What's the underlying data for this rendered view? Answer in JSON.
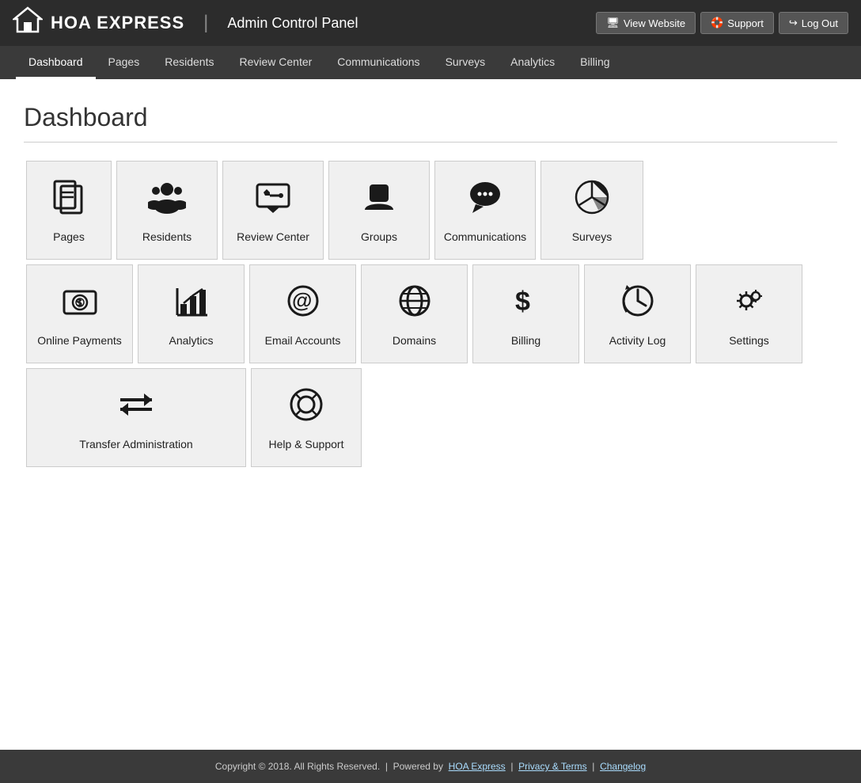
{
  "header": {
    "logo_text": "HOA EXPRESS",
    "admin_title": "Admin Control Panel",
    "view_website_btn": "View Website",
    "support_btn": "Support",
    "logout_btn": "Log Out"
  },
  "nav": {
    "items": [
      {
        "label": "Dashboard",
        "active": true
      },
      {
        "label": "Pages",
        "active": false
      },
      {
        "label": "Residents",
        "active": false
      },
      {
        "label": "Review Center",
        "active": false
      },
      {
        "label": "Communications",
        "active": false
      },
      {
        "label": "Surveys",
        "active": false
      },
      {
        "label": "Analytics",
        "active": false
      },
      {
        "label": "Billing",
        "active": false
      }
    ]
  },
  "main": {
    "page_title": "Dashboard",
    "row1": [
      {
        "label": "Pages",
        "icon": "pages"
      },
      {
        "label": "Residents",
        "icon": "residents"
      },
      {
        "label": "Review Center",
        "icon": "review"
      },
      {
        "label": "Groups",
        "icon": "groups"
      },
      {
        "label": "Communications",
        "icon": "communications"
      },
      {
        "label": "Surveys",
        "icon": "surveys"
      }
    ],
    "row2": [
      {
        "label": "Online Payments",
        "icon": "payments"
      },
      {
        "label": "Analytics",
        "icon": "analytics"
      },
      {
        "label": "Email Accounts",
        "icon": "email"
      },
      {
        "label": "Domains",
        "icon": "domains"
      },
      {
        "label": "Billing",
        "icon": "billing"
      },
      {
        "label": "Activity Log",
        "icon": "activity"
      },
      {
        "label": "Settings",
        "icon": "settings"
      }
    ],
    "row3": [
      {
        "label": "Transfer Administration",
        "icon": "transfer"
      },
      {
        "label": "Help & Support",
        "icon": "help"
      }
    ]
  },
  "footer": {
    "copyright": "Copyright © 2018. All Rights Reserved.",
    "powered_by": "Powered by",
    "hoa_express": "HOA Express",
    "privacy": "Privacy & Terms",
    "changelog": "Changelog"
  }
}
